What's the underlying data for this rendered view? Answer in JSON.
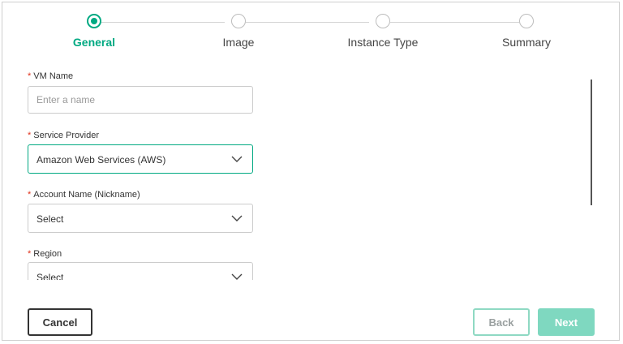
{
  "stepper": {
    "steps": [
      {
        "label": "General",
        "active": true
      },
      {
        "label": "Image",
        "active": false
      },
      {
        "label": "Instance Type",
        "active": false
      },
      {
        "label": "Summary",
        "active": false
      }
    ]
  },
  "form": {
    "vm_name": {
      "label": "VM Name",
      "required_mark": "*",
      "placeholder": "Enter a name",
      "value": ""
    },
    "service_provider": {
      "label": "Service Provider",
      "required_mark": "*",
      "value": "Amazon Web Services (AWS)"
    },
    "account_name": {
      "label": "Account Name (Nickname)",
      "required_mark": "*",
      "value": "Select"
    },
    "region": {
      "label": "Region",
      "required_mark": "*",
      "value": "Select"
    }
  },
  "footer": {
    "cancel_label": "Cancel",
    "back_label": "Back",
    "next_label": "Next"
  },
  "colors": {
    "accent": "#01a982",
    "required": "#e0311b",
    "next_disabled": "#7fd8c0"
  }
}
